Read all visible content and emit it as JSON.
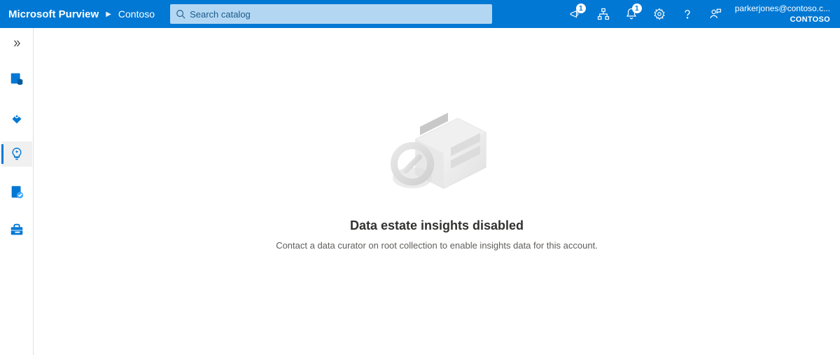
{
  "header": {
    "brand": "Microsoft Purview",
    "breadcrumb": "Contoso",
    "search_placeholder": "Search catalog",
    "user_email": "parkerjones@contoso.c...",
    "user_org": "CONTOSO",
    "badge_diagnostics": "1",
    "badge_notifications": "1"
  },
  "sidebar": {
    "items": [
      {
        "name": "data-catalog"
      },
      {
        "name": "data-map"
      },
      {
        "name": "data-estate-insights"
      },
      {
        "name": "data-policy"
      },
      {
        "name": "management"
      }
    ]
  },
  "main": {
    "title": "Data estate insights disabled",
    "description": "Contact a data curator on root collection to enable insights data for this account."
  }
}
